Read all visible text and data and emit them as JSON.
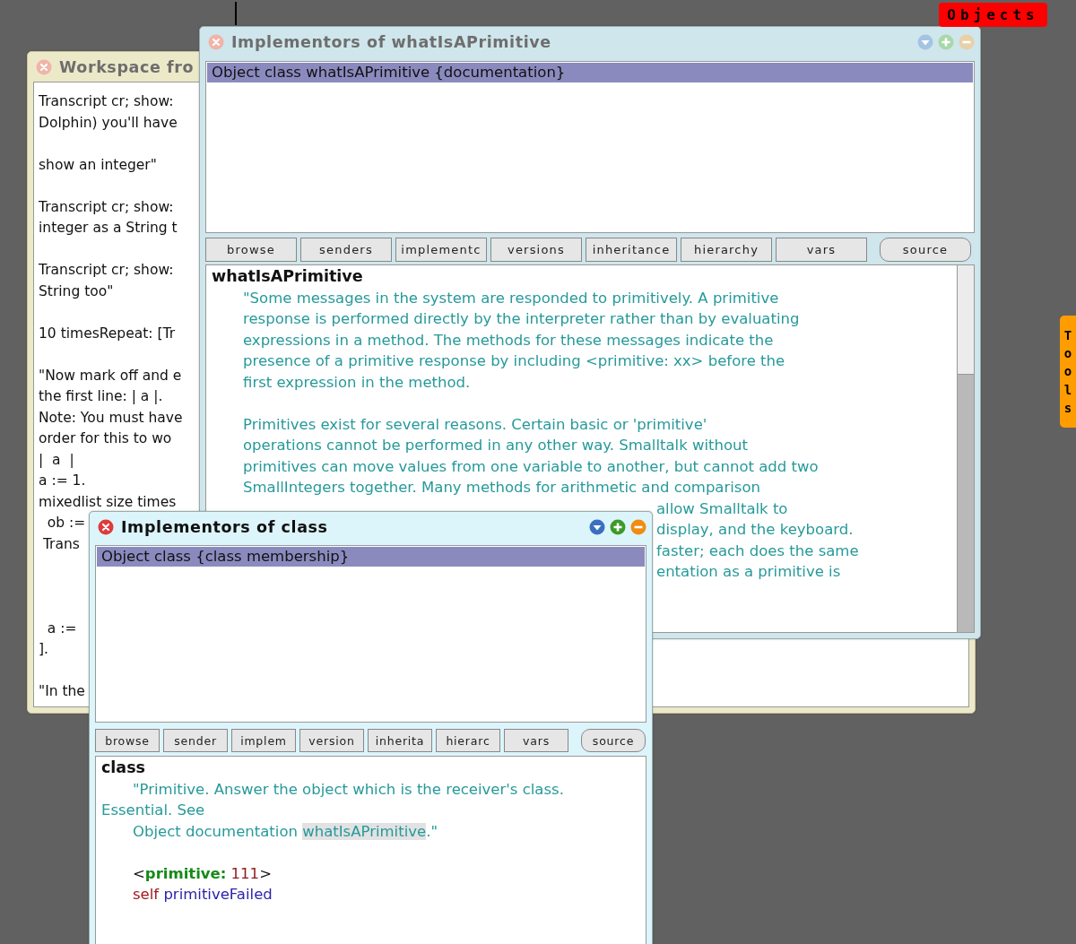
{
  "flaps": [
    {
      "kind": "top",
      "label": "Objects"
    },
    {
      "kind": "side",
      "label": "Tools"
    }
  ],
  "windows": [
    {
      "kind": "workspace",
      "title": "Workspace fro",
      "active": false,
      "lines": [
        {
          "kind": "text",
          "text": "Transcript cr; show:"
        },
        {
          "kind": "text",
          "text": "Dolphin) you'll have"
        },
        {
          "kind": "blank"
        },
        {
          "kind": "text",
          "text": "show an integer\""
        },
        {
          "kind": "blank"
        },
        {
          "kind": "text",
          "text": "Transcript cr; show:"
        },
        {
          "kind": "text",
          "text": "integer as a String t"
        },
        {
          "kind": "blank"
        },
        {
          "kind": "text",
          "text": "Transcript cr; show:"
        },
        {
          "kind": "text",
          "text": "String too\""
        },
        {
          "kind": "blank"
        },
        {
          "kind": "text",
          "text": "10 timesRepeat: [Tr"
        },
        {
          "kind": "blank"
        },
        {
          "kind": "text",
          "text": "\"Now mark off and e"
        },
        {
          "kind": "text",
          "text": "the first line: | a |."
        },
        {
          "kind": "text",
          "text": "Note: You must have"
        },
        {
          "kind": "text",
          "text": "order for this to wo"
        },
        {
          "kind": "text",
          "text": "|  a  |"
        },
        {
          "kind": "text",
          "text": "a := 1."
        },
        {
          "kind": "text",
          "text": "mixedlist size times"
        },
        {
          "kind": "text",
          "text": "  ob :="
        },
        {
          "kind": "text",
          "text": " Trans"
        },
        {
          "kind": "blank"
        },
        {
          "kind": "blank"
        },
        {
          "kind": "blank"
        },
        {
          "kind": "text",
          "text": "  a :="
        },
        {
          "kind": "text",
          "text": "]."
        },
        {
          "kind": "blank"
        },
        {
          "kind": "text",
          "text": "\"In the"
        }
      ]
    },
    {
      "kind": "browser",
      "title": "Implementors of whatIsAPrimitive",
      "active": false,
      "list": [
        {
          "label": "Object class whatIsAPrimitive {documentation}",
          "selected": true
        }
      ],
      "buttons": [
        {
          "kind": "action",
          "label": "browse"
        },
        {
          "kind": "action",
          "label": "senders"
        },
        {
          "kind": "action",
          "label": "implementc"
        },
        {
          "kind": "action",
          "label": "versions"
        },
        {
          "kind": "action",
          "label": "inheritance"
        },
        {
          "kind": "action",
          "label": "hierarchy"
        },
        {
          "kind": "action",
          "label": "vars"
        },
        {
          "kind": "toggle",
          "label": "source"
        }
      ],
      "method_name": "whatIsAPrimitive",
      "code": [
        {
          "kind": "text",
          "indented": true,
          "segments": [
            {
              "kind": "comment",
              "text": "\"Some messages in the system are responded to primitively. A primitive"
            }
          ]
        },
        {
          "kind": "text",
          "indented": true,
          "segments": [
            {
              "kind": "comment",
              "text": "response is performed directly by the interpreter rather than by evaluating"
            }
          ]
        },
        {
          "kind": "text",
          "indented": true,
          "segments": [
            {
              "kind": "comment",
              "text": "expressions in a method. The methods for these messages indicate the"
            }
          ]
        },
        {
          "kind": "text",
          "indented": true,
          "segments": [
            {
              "kind": "comment",
              "text": "presence of a primitive response by including <primitive: xx> before the"
            }
          ]
        },
        {
          "kind": "text",
          "indented": true,
          "segments": [
            {
              "kind": "comment",
              "text": "first expression in the method."
            }
          ]
        },
        {
          "kind": "blank"
        },
        {
          "kind": "text",
          "indented": true,
          "segments": [
            {
              "kind": "comment",
              "text": "Primitives exist for several reasons. Certain basic or 'primitive'"
            }
          ]
        },
        {
          "kind": "text",
          "indented": true,
          "segments": [
            {
              "kind": "comment",
              "text": "operations cannot be performed in any other way. Smalltalk without"
            }
          ]
        },
        {
          "kind": "text",
          "indented": true,
          "segments": [
            {
              "kind": "comment",
              "text": "primitives can move values from one variable to another, but cannot add two"
            }
          ]
        },
        {
          "kind": "text",
          "indented": true,
          "segments": [
            {
              "kind": "comment",
              "text": "SmallIntegers together. Many methods for arithmetic and comparison"
            }
          ]
        }
      ],
      "covered_lines": [
        "allow Smalltalk to",
        "display, and the keyboard.",
        "faster; each does the same",
        "entation as a primitive is"
      ]
    },
    {
      "kind": "browser",
      "title": "Implementors of class",
      "active": true,
      "list": [
        {
          "label": "Object class {class membership}",
          "selected": true
        }
      ],
      "buttons": [
        {
          "kind": "action",
          "label": "browse"
        },
        {
          "kind": "action",
          "label": "sender"
        },
        {
          "kind": "action",
          "label": "implem"
        },
        {
          "kind": "action",
          "label": "version"
        },
        {
          "kind": "action",
          "label": "inherita"
        },
        {
          "kind": "action",
          "label": "hierarc"
        },
        {
          "kind": "action",
          "label": "vars"
        },
        {
          "kind": "toggle",
          "label": "source"
        }
      ],
      "method_name": "class",
      "code": [
        {
          "kind": "text",
          "indented": true,
          "segments": [
            {
              "kind": "comment",
              "text": "\"Primitive. Answer the object which is the receiver's class."
            }
          ]
        },
        {
          "kind": "text",
          "indented": false,
          "segments": [
            {
              "kind": "comment",
              "text": "Essential. See"
            }
          ]
        },
        {
          "kind": "text",
          "indented": true,
          "segments": [
            {
              "kind": "comment",
              "text": "Object documentation "
            },
            {
              "kind": "highlight",
              "text": "whatIsAPrimitive"
            },
            {
              "kind": "comment",
              "text": ".\""
            }
          ]
        },
        {
          "kind": "blank"
        },
        {
          "kind": "text",
          "indented": true,
          "segments": [
            {
              "kind": "punct",
              "text": "<"
            },
            {
              "kind": "keyword",
              "text": "primitive:"
            },
            {
              "kind": "number",
              "text": " 111"
            },
            {
              "kind": "punct",
              "text": ">"
            }
          ]
        },
        {
          "kind": "text",
          "indented": true,
          "segments": [
            {
              "kind": "self",
              "text": "self"
            },
            {
              "kind": "message",
              "text": " primitiveFailed"
            }
          ]
        }
      ]
    }
  ]
}
